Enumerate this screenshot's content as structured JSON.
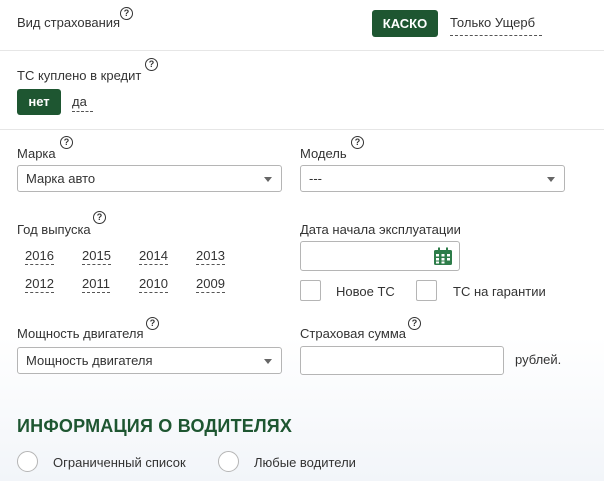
{
  "insurance_type": {
    "label": "Вид страхования",
    "options": [
      "КАСКО",
      "Только Ущерб"
    ],
    "selected": "КАСКО"
  },
  "credit": {
    "label": "ТС куплено в кредит",
    "options": [
      "нет",
      "да"
    ],
    "selected": "нет"
  },
  "brand": {
    "label": "Марка",
    "value": "Марка авто"
  },
  "model": {
    "label": "Модель",
    "value": "---"
  },
  "year": {
    "label": "Год выпуска",
    "row1": [
      "2016",
      "2015",
      "2014",
      "2013"
    ],
    "row2": [
      "2012",
      "2011",
      "2010",
      "2009"
    ]
  },
  "operation_start": {
    "label": "Дата начала эксплуатации",
    "value": ""
  },
  "checkboxes": {
    "new": "Новое ТС",
    "warranty": "ТС на гарантии"
  },
  "power": {
    "label": "Мощность двигателя",
    "value": "Мощность двигателя"
  },
  "sum": {
    "label": "Страховая сумма",
    "value": "",
    "unit": "рублей."
  },
  "drivers": {
    "title": "ИНФОРМАЦИЯ О ВОДИТЕЛЯХ",
    "options": [
      "Ограниченный список",
      "Любые водители"
    ]
  },
  "icons": {
    "help": "?",
    "calendar": "calendar-icon"
  },
  "colors": {
    "accent": "#1e5631",
    "calendar": "#2e7d4a"
  }
}
